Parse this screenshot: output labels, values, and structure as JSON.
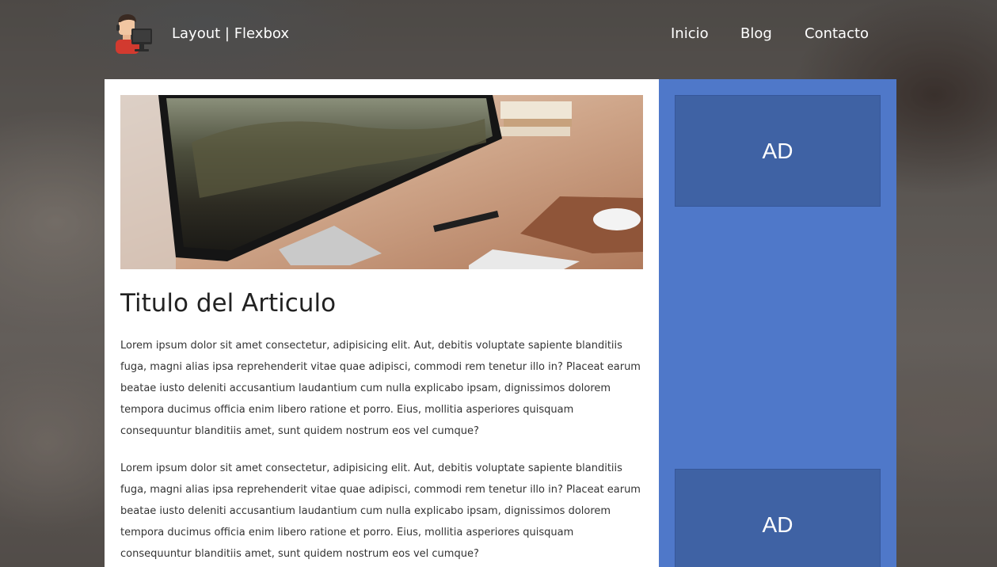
{
  "header": {
    "site_title": "Layout | Flexbox",
    "logo_icon": "developer-avatar-icon",
    "nav": [
      {
        "label": "Inicio"
      },
      {
        "label": "Blog"
      },
      {
        "label": "Contacto"
      }
    ]
  },
  "article": {
    "hero_image": "desk-with-imac-photo",
    "title": "Titulo del Articulo",
    "paragraphs": [
      "Lorem ipsum dolor sit amet consectetur, adipisicing elit. Aut, debitis voluptate sapiente blanditiis fuga, magni alias ipsa reprehenderit vitae quae adipisci, commodi rem tenetur illo in? Placeat earum beatae iusto deleniti accusantium laudantium cum nulla explicabo ipsam, dignissimos dolorem tempora ducimus officia enim libero ratione et porro. Eius, mollitia asperiores quisquam consequuntur blanditiis amet, sunt quidem nostrum eos vel cumque?",
      "Lorem ipsum dolor sit amet consectetur, adipisicing elit. Aut, debitis voluptate sapiente blanditiis fuga, magni alias ipsa reprehenderit vitae quae adipisci, commodi rem tenetur illo in? Placeat earum beatae iusto deleniti accusantium laudantium cum nulla explicabo ipsam, dignissimos dolorem tempora ducimus officia enim libero ratione et porro. Eius, mollitia asperiores quisquam consequuntur blanditiis amet, sunt quidem nostrum eos vel cumque?"
    ]
  },
  "sidebar": {
    "ads": [
      {
        "label": "AD"
      },
      {
        "label": "AD"
      }
    ]
  },
  "colors": {
    "sidebar": "#4f78c9",
    "ad_box": "#3f62a4",
    "article_bg": "#ffffff",
    "header_text": "#ffffff"
  }
}
